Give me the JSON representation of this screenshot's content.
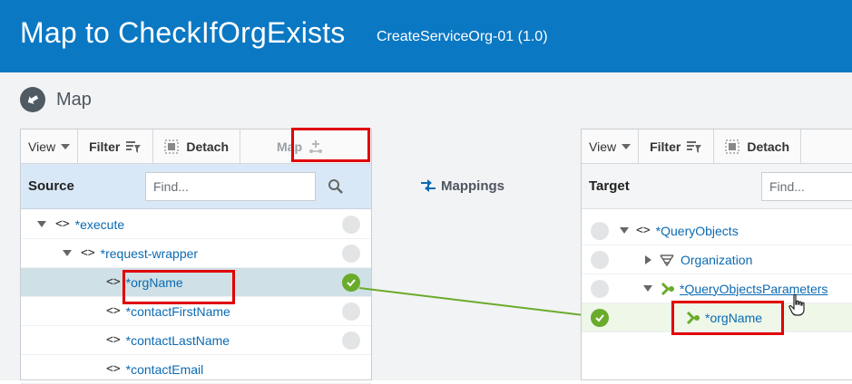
{
  "header": {
    "title": "Map to CheckIfOrgExists",
    "subtitle": "CreateServiceOrg-01 (1.0)",
    "bg_color": "#0b78c3"
  },
  "section": {
    "title": "Map",
    "icon": "map-icon"
  },
  "source_panel": {
    "toolbar": {
      "view": "View",
      "filter": "Filter",
      "detach": "Detach",
      "map": "Map"
    },
    "header_label": "Source",
    "find_placeholder": "Find...",
    "rows": [
      {
        "prefix": "*",
        "name": "execute"
      },
      {
        "prefix": "*",
        "name": "request-wrapper"
      },
      {
        "prefix": "*",
        "name": "orgName"
      },
      {
        "prefix": "*",
        "name": "contactFirstName"
      },
      {
        "prefix": "*",
        "name": "contactLastName"
      },
      {
        "prefix": "*",
        "name": "contactEmail"
      }
    ]
  },
  "mappings_label": "Mappings",
  "target_panel": {
    "toolbar": {
      "view": "View",
      "filter": "Filter",
      "detach": "Detach"
    },
    "header_label": "Target",
    "find_placeholder": "Find...",
    "rows": [
      {
        "prefix": "*",
        "name": "QueryObjects"
      },
      {
        "prefix": "",
        "name": "Organization"
      },
      {
        "prefix": "*",
        "name": "QueryObjectsParameters"
      },
      {
        "prefix": "*",
        "name": "orgName"
      }
    ]
  },
  "colors": {
    "accent": "#0b78c3",
    "mapped": "#6aab2b",
    "highlight": "#e00000",
    "selected_row": "#cfe1e6"
  }
}
